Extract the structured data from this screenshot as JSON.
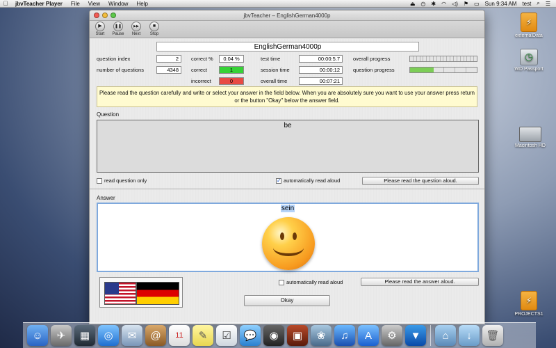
{
  "menubar": {
    "app_name": "jbvTeacher Player",
    "items": [
      "File",
      "View",
      "Window",
      "Help"
    ],
    "clock": "Sun 9:34 AM",
    "user": "test"
  },
  "desktop": {
    "icons": [
      {
        "label": "externalData"
      },
      {
        "label": "WD Passport"
      },
      {
        "label": "Macintosh HD"
      },
      {
        "label": "PROJECTS1"
      }
    ]
  },
  "window": {
    "title": "jbvTeacher – EnglishGerman4000p",
    "toolbar": [
      {
        "label": "Start",
        "glyph": "▶"
      },
      {
        "label": "Pause",
        "glyph": "❚❚"
      },
      {
        "label": "Next",
        "glyph": "▶▶"
      },
      {
        "label": "Stop",
        "glyph": "■"
      }
    ]
  },
  "lesson": {
    "title": "EnglishGerman4000p"
  },
  "stats": {
    "question_index_label": "question index",
    "question_index": "2",
    "number_of_questions_label": "number of questions",
    "number_of_questions": "4348",
    "correct_pct_label": "correct %",
    "correct_pct": "0.04 %",
    "correct_label": "correct",
    "correct": "1",
    "incorrect_label": "incorrect",
    "incorrect": "0",
    "test_time_label": "test time",
    "test_time": "00:00:5.7",
    "session_time_label": "session time",
    "session_time": "00:00:12",
    "overall_time_label": "overall time",
    "overall_time": "00:07:21",
    "overall_progress_label": "overall progress",
    "overall_progress": 0.0,
    "question_progress_label": "question progress",
    "question_progress": 0.35,
    "colors": {
      "correct": "#36d236",
      "incorrect": "#e84a44",
      "progress": "#7ccd56"
    }
  },
  "instructions": "Please read the question carefully and write or select your answer in the field below. When you are absolutely sure you want to use your answer press return or the button \"Okay\" below the answer field.",
  "question": {
    "section_label": "Question",
    "text": "be",
    "read_only_label": "read question only",
    "read_only_checked": false,
    "auto_read_label": "automatically read aloud",
    "auto_read_checked": true,
    "read_button": "Please read the question aloud."
  },
  "answer": {
    "section_label": "Answer",
    "text": "sein",
    "auto_read_label": "automatically read aloud",
    "auto_read_checked": false,
    "read_button": "Please read the answer aloud.",
    "okay_button": "Okay"
  }
}
